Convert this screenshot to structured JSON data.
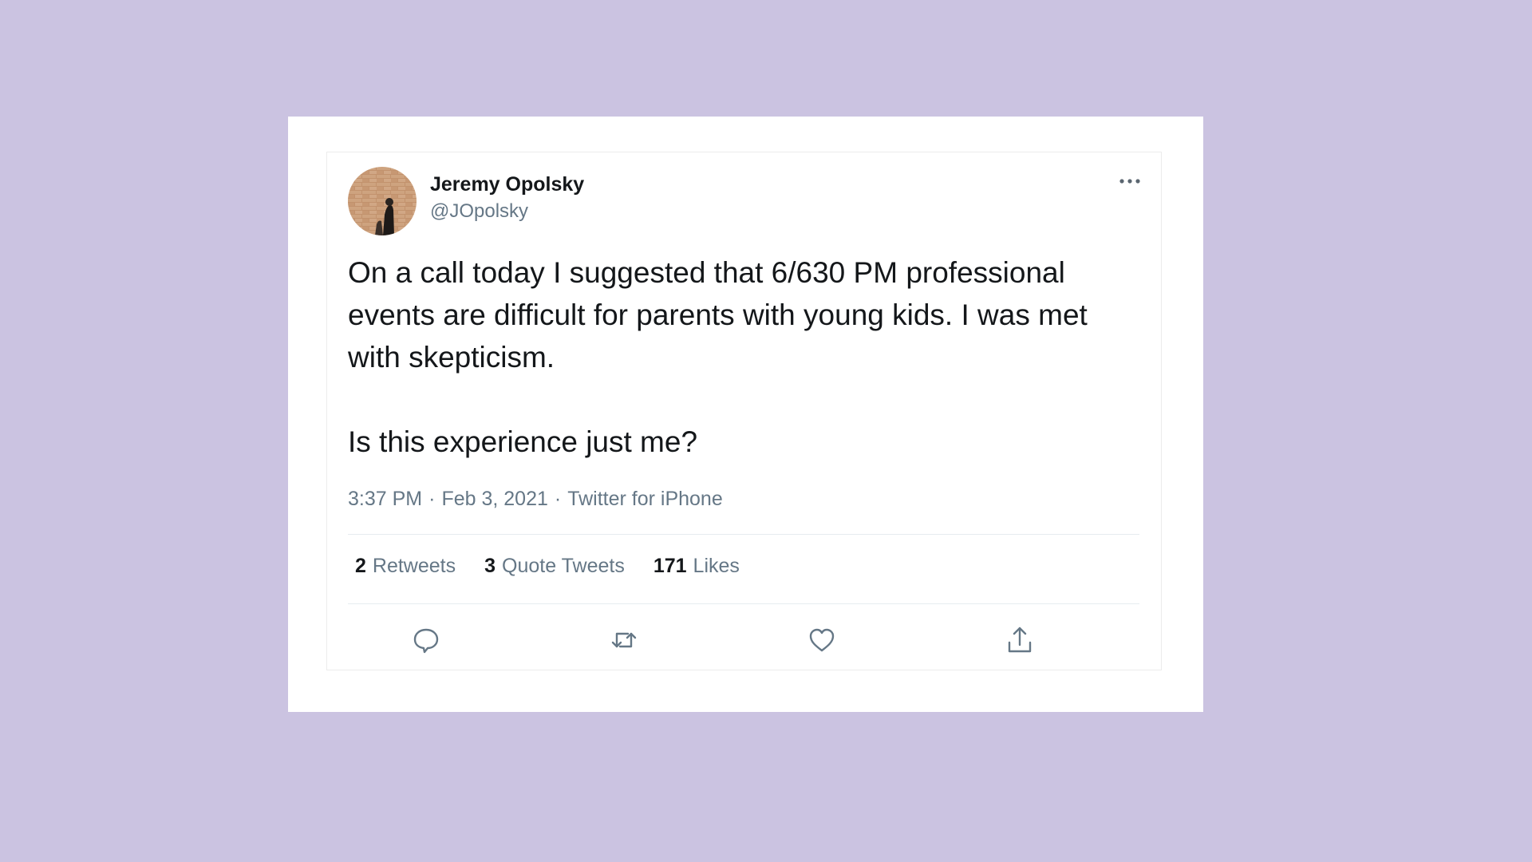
{
  "colors": {
    "page_background": "#cbc3e1",
    "card_background": "#ffffff",
    "text_primary": "#14171a",
    "text_secondary": "#657786",
    "divider": "#e6ecf0"
  },
  "author": {
    "name": "Jeremy Opolsky",
    "handle": "@JOpolsky",
    "avatar_icon": "profile-photo"
  },
  "more_icon": "ellipsis-icon",
  "tweet": {
    "text": "On a call today I suggested that 6/630 PM professional events are difficult for parents with young kids. I was met with skepticism.\n\nIs this experience just me?",
    "time": "3:37 PM",
    "date": "Feb 3, 2021",
    "separator": "·",
    "source": "Twitter for iPhone"
  },
  "stats": {
    "retweets_count": "2",
    "retweets_label": "Retweets",
    "quote_tweets_count": "3",
    "quote_tweets_label": "Quote Tweets",
    "likes_count": "171",
    "likes_label": "Likes"
  },
  "actions": [
    {
      "icon": "reply-icon"
    },
    {
      "icon": "retweet-icon"
    },
    {
      "icon": "like-icon"
    },
    {
      "icon": "share-icon"
    }
  ]
}
